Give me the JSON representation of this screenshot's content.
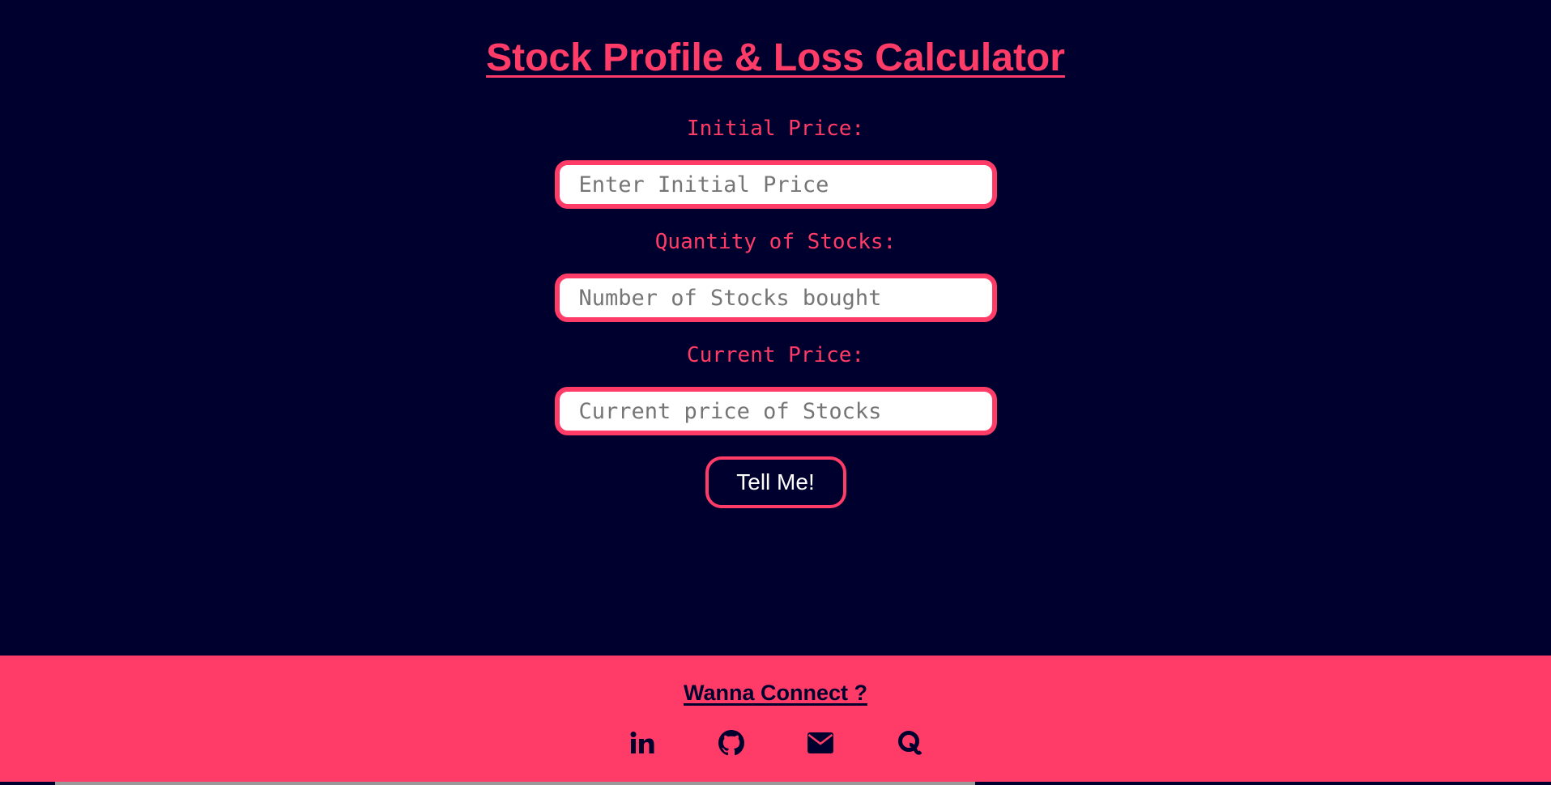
{
  "page": {
    "title": "Stock Profile & Loss Calculator"
  },
  "form": {
    "initial_price": {
      "label": "Initial Price:",
      "placeholder": "Enter Initial Price",
      "value": ""
    },
    "quantity": {
      "label": "Quantity of Stocks:",
      "placeholder": "Number of Stocks bought",
      "value": ""
    },
    "current_price": {
      "label": "Current Price:",
      "placeholder": "Current price of Stocks",
      "value": ""
    },
    "submit_label": "Tell Me!"
  },
  "footer": {
    "title": "Wanna Connect ?",
    "links": [
      {
        "icon": "linkedin-icon"
      },
      {
        "icon": "github-icon"
      },
      {
        "icon": "mail-icon"
      },
      {
        "icon": "quora-icon"
      }
    ]
  },
  "colors": {
    "background": "#00002e",
    "accent": "#ff3b67",
    "text_light": "#ffffff"
  }
}
